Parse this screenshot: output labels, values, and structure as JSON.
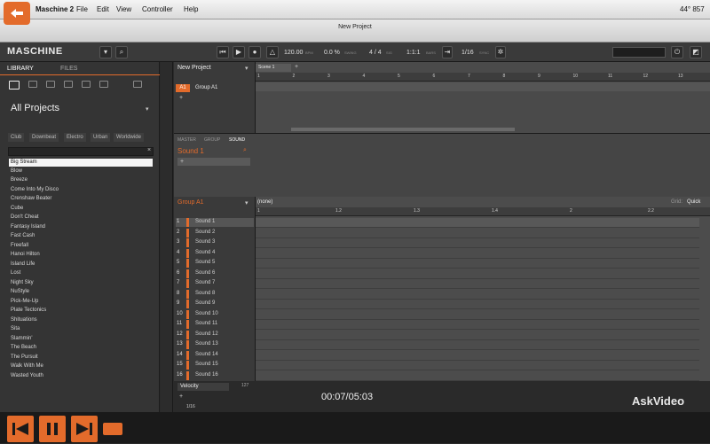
{
  "menubar": {
    "app": "Maschine 2",
    "items": [
      "File",
      "Edit",
      "View",
      "Controller",
      "Help"
    ],
    "right": "44° 857"
  },
  "window_title": "New Project",
  "toolbar": {
    "logo": "MASCHINE",
    "bpm": "120.00",
    "bpm_label": "BPM",
    "swing": "0.0 %",
    "swing_label": "SWING",
    "sig": "4 / 4",
    "sig_label": "SIG",
    "bars": "1:1:1",
    "bars_label": "BARS",
    "sync": "1/16",
    "sync_label": "SYNC"
  },
  "library": {
    "tab_library": "LIBRARY",
    "tab_files": "FILES",
    "title": "All Projects",
    "tags": [
      "Club",
      "Downbeat",
      "Electro",
      "Urban",
      "Worldwide"
    ],
    "projects": [
      "Big Stream",
      "Blow",
      "Breeze",
      "Come Into My Disco",
      "Crenshaw Beater",
      "Cube",
      "Don't Cheat",
      "Fantasy Island",
      "Fast Cash",
      "Freefall",
      "Hanoi Hilton",
      "Island Life",
      "Lost",
      "Night Sky",
      "NuStyle",
      "Pick-Me-Up",
      "Plate Tectonics",
      "Shituations",
      "Sita",
      "Slammin'",
      "The Beach",
      "The Pursuit",
      "Walk With Me",
      "Wasted Youth"
    ]
  },
  "arranger": {
    "project": "New Project",
    "scene": "Scene 1",
    "group": "Group A1",
    "group_id": "A1",
    "ticks": [
      "1",
      "2",
      "3",
      "4",
      "5",
      "6",
      "7",
      "8",
      "9",
      "10",
      "11",
      "12",
      "13"
    ]
  },
  "sound_panel": {
    "tabs": [
      "MASTER",
      "GROUP",
      "SOUND"
    ],
    "sound": "Sound 1"
  },
  "pattern": {
    "group": "Group A1",
    "name": "(none)",
    "grid_label": "Grid:",
    "grid_value": "Quick",
    "ticks": [
      "1",
      "1.2",
      "1.3",
      "1.4",
      "2",
      "2.2"
    ],
    "sounds": [
      "Sound 1",
      "Sound 2",
      "Sound 3",
      "Sound 4",
      "Sound 5",
      "Sound 6",
      "Sound 7",
      "Sound 8",
      "Sound 9",
      "Sound 10",
      "Sound 11",
      "Sound 12",
      "Sound 13",
      "Sound 14",
      "Sound 15",
      "Sound 16"
    ]
  },
  "controls": {
    "param": "Velocity",
    "value": "127",
    "step": "1/16"
  },
  "video": {
    "timecode": "00:07/05:03",
    "brand": "AskVideo"
  },
  "colors": {
    "accent": "#e36b2b"
  }
}
